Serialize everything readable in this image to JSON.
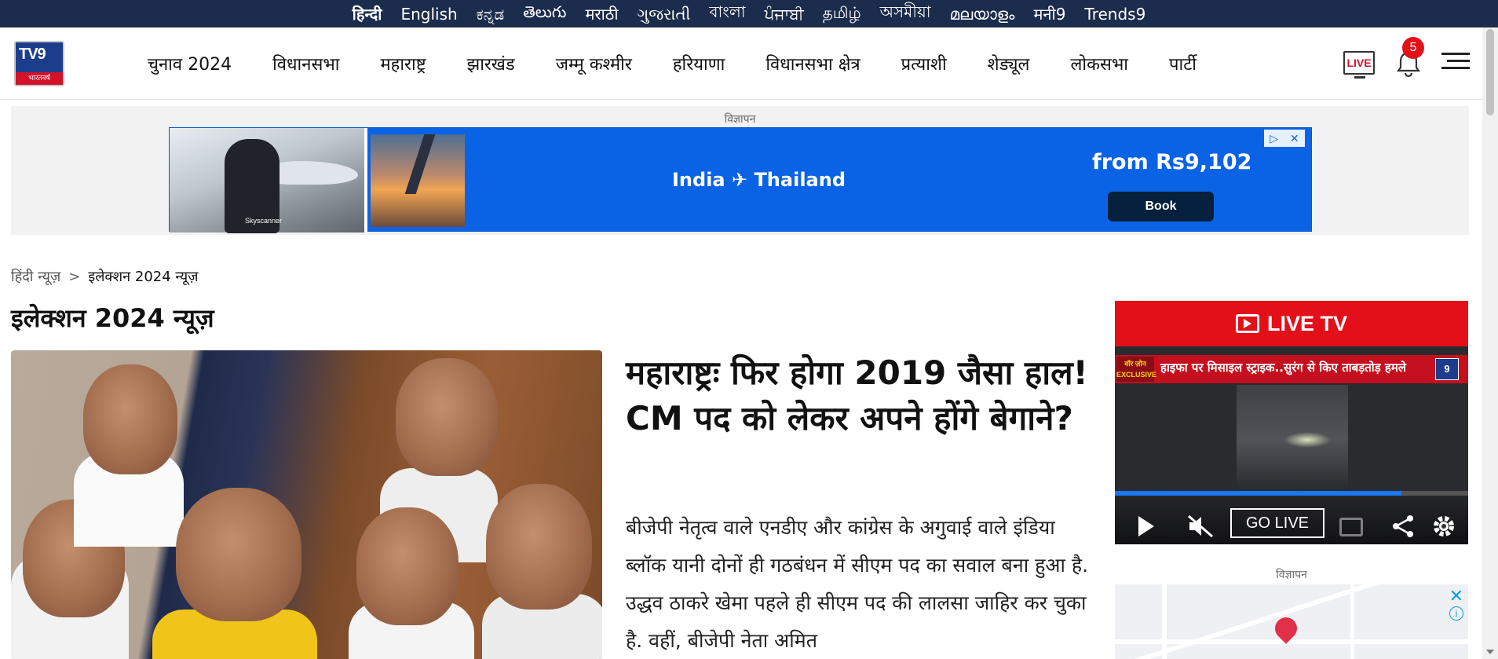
{
  "languages": [
    {
      "label": "हिन्दी",
      "active": true
    },
    {
      "label": "English"
    },
    {
      "label": "ಕನ್ನಡ"
    },
    {
      "label": "తెలుగు"
    },
    {
      "label": "मराठी"
    },
    {
      "label": "ગુજરાતી"
    },
    {
      "label": "বাংলা"
    },
    {
      "label": "ਪੰਜਾਬੀ"
    },
    {
      "label": "தமிழ்"
    },
    {
      "label": "অসমীয়া"
    },
    {
      "label": "മലയാളം"
    },
    {
      "label": "मनी9"
    },
    {
      "label": "Trends9"
    }
  ],
  "header": {
    "logo_text": "TV9",
    "logo_sub": "भारतवर्ष",
    "nav": [
      "चुनाव 2024",
      "विधानसभा",
      "महाराष्ट्र",
      "झारखंड",
      "जम्मू कश्मीर",
      "हरियाणा",
      "विधानसभा क्षेत्र",
      "प्रत्याशी",
      "शेड्यूल",
      "लोकसभा",
      "पार्टी"
    ],
    "live_label": "LIVE",
    "notification_count": "5"
  },
  "ad_top": {
    "label": "विज्ञापन",
    "route": "India ✈ Thailand",
    "price": "from Rs9,102",
    "cta": "Book",
    "brand": "Skyscanner"
  },
  "breadcrumb": {
    "home": "हिंदी न्यूज़",
    "separator": ">",
    "current": "इलेक्शन 2024 न्यूज़"
  },
  "page_title": "इलेक्शन 2024 न्यूज़",
  "hero": {
    "headline": "महाराष्ट्रः फिर होगा 2019 जैसा हाल! CM पद को लेकर अपने होंगे बेगाने?",
    "summary": "बीजेपी नेतृत्व वाले एनडीए और कांग्रेस के अगुवाई वाले इंडिया ब्लॉक यानी दोनों ही गठबंधन में सीएम पद का सवाल बना हुआ है. उद्धव ठाकरे खेमा पहले ही सीएम पद की लालसा जाहिर कर चुका है. वहीं, बीजेपी नेता अमित"
  },
  "live_tv": {
    "title": "LIVE TV",
    "ticker_tag": "वॉर ज़ोन EXCLUSIVE",
    "ticker_text": "हाइफा पर मिसाइल स्ट्राइक..सुरंग से किए ताबड़तोड़ हमले",
    "go_live": "GO LIVE",
    "progress": 0.81
  },
  "ad_side": {
    "label": "विज्ञापन",
    "close": "✕",
    "info": "i"
  }
}
